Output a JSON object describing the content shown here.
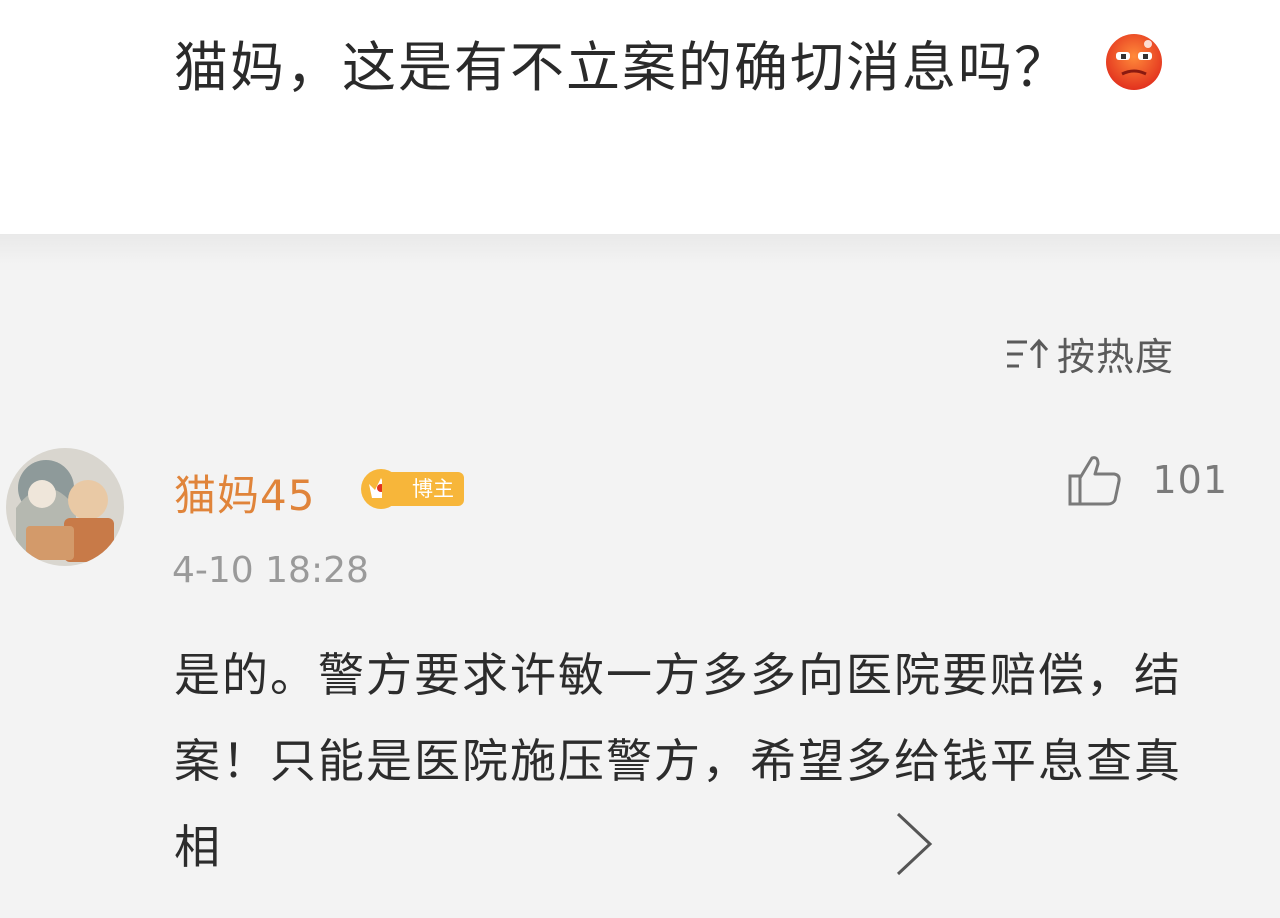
{
  "post": {
    "text": "猫妈，这是有不立案的确切消息吗？",
    "emoji": "angry-face-emoji"
  },
  "sort": {
    "label": "按热度",
    "icon": "sort-icon"
  },
  "comment": {
    "username": "猫妈45",
    "badge_label": "博主",
    "timestamp": "4-10 18:28",
    "like_count": "101",
    "text": "是的。警方要求许敏一方多多向医院要赔偿，结案！只能是医院施压警方，希望多给钱平息查真相"
  },
  "colors": {
    "username": "#e0843a",
    "badge": "#f7b63a",
    "text": "#2c2c2c",
    "meta": "#9a9a9a"
  }
}
